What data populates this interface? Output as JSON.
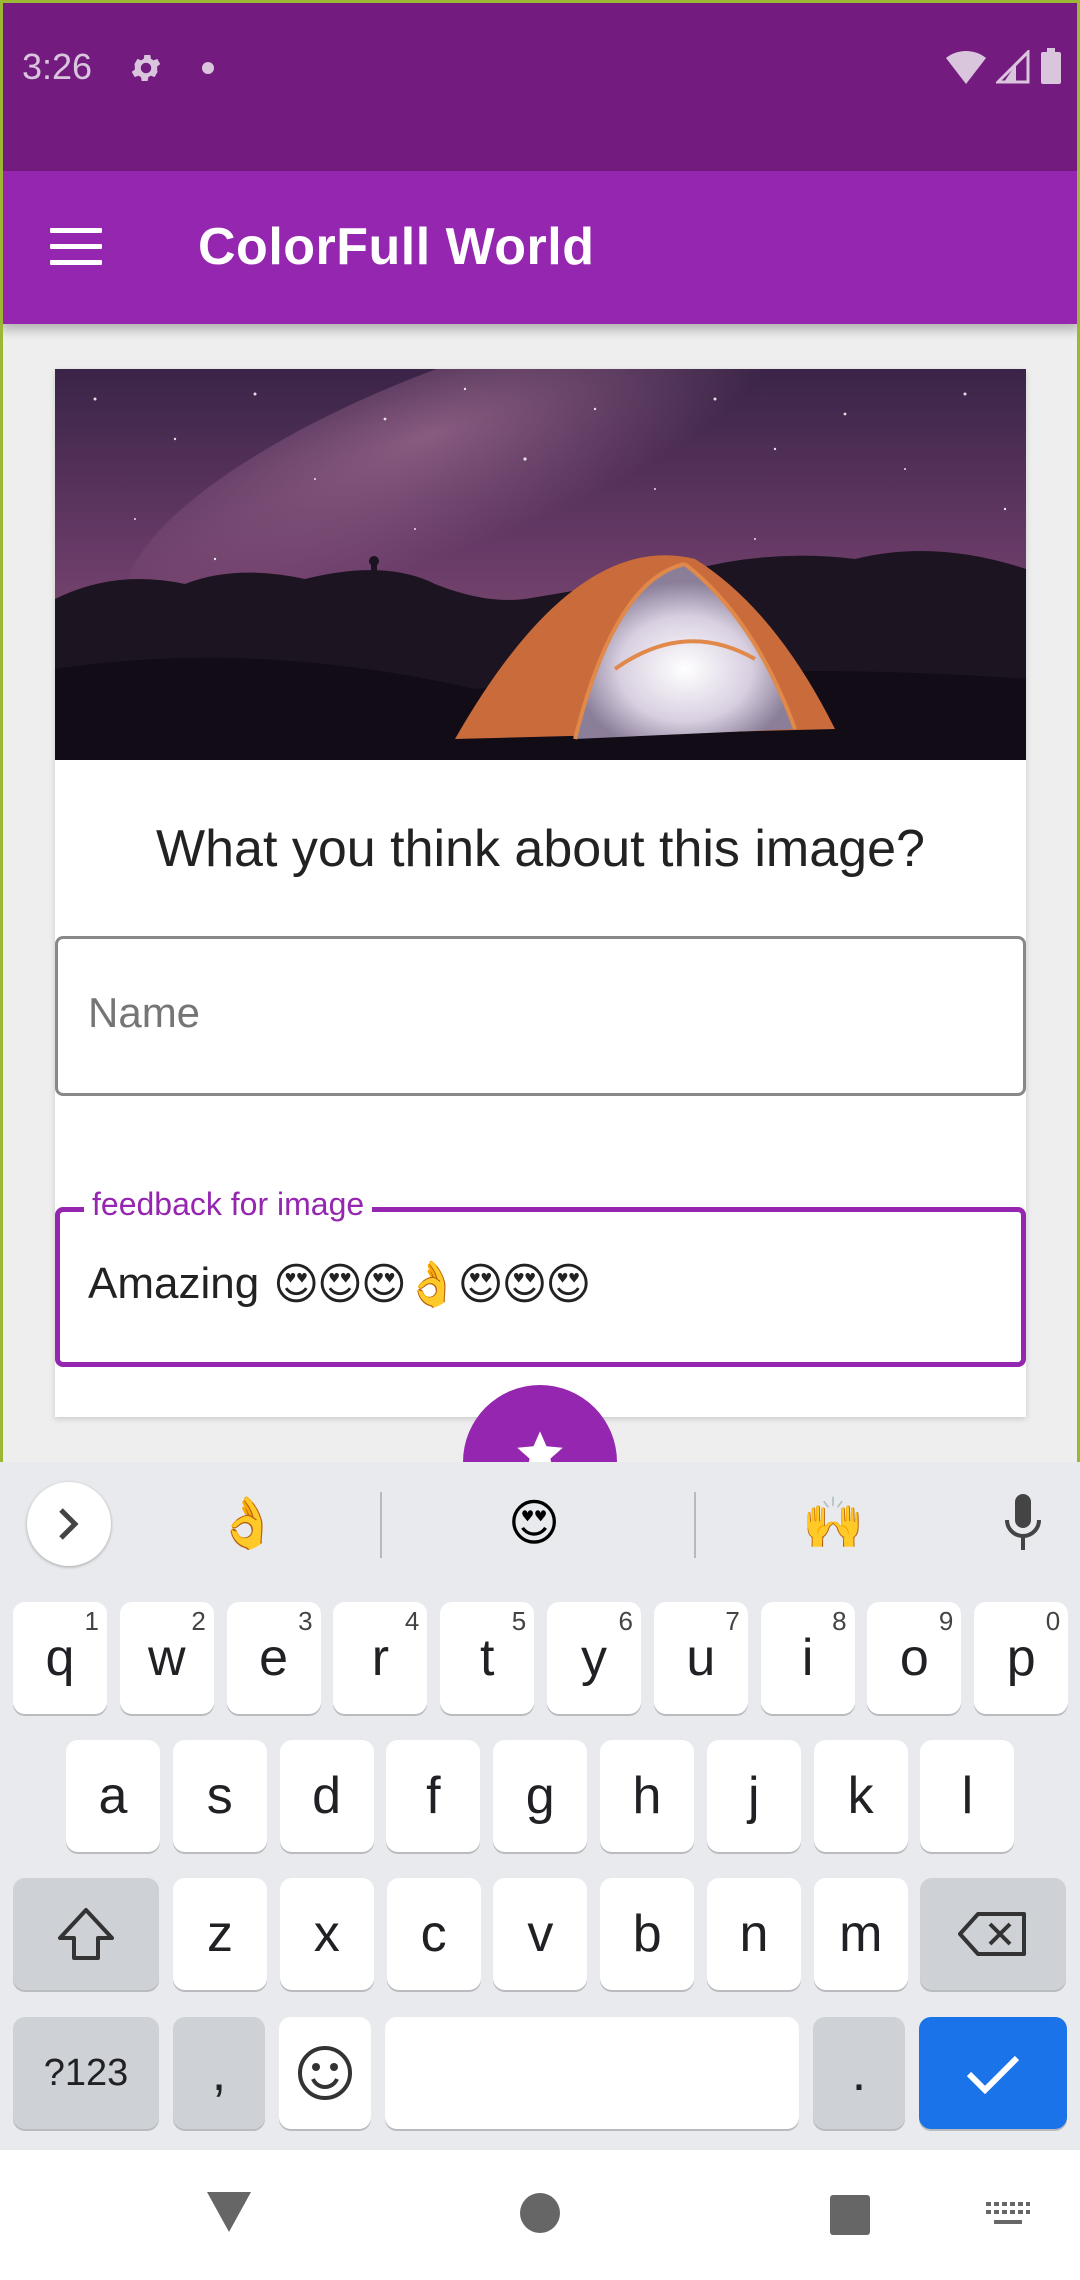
{
  "status_bar": {
    "time": "3:26"
  },
  "app_bar": {
    "title": "ColorFull World"
  },
  "card": {
    "question": "What you think about this image?",
    "name_field": {
      "placeholder": "Name"
    },
    "feedback_field": {
      "label": "feedback for image",
      "value_text": "Amazing",
      "value_emojis": "😍😍😍👌😍😍😍"
    }
  },
  "keyboard": {
    "suggestions": [
      "👌",
      "😍",
      "🙌"
    ],
    "row1": [
      {
        "k": "q",
        "n": "1"
      },
      {
        "k": "w",
        "n": "2"
      },
      {
        "k": "e",
        "n": "3"
      },
      {
        "k": "r",
        "n": "4"
      },
      {
        "k": "t",
        "n": "5"
      },
      {
        "k": "y",
        "n": "6"
      },
      {
        "k": "u",
        "n": "7"
      },
      {
        "k": "i",
        "n": "8"
      },
      {
        "k": "o",
        "n": "9"
      },
      {
        "k": "p",
        "n": "0"
      }
    ],
    "row2": [
      "a",
      "s",
      "d",
      "f",
      "g",
      "h",
      "j",
      "k",
      "l"
    ],
    "row3": [
      "z",
      "x",
      "c",
      "v",
      "b",
      "n",
      "m"
    ],
    "symbols_label": "?123",
    "comma_label": ",",
    "period_label": "."
  }
}
